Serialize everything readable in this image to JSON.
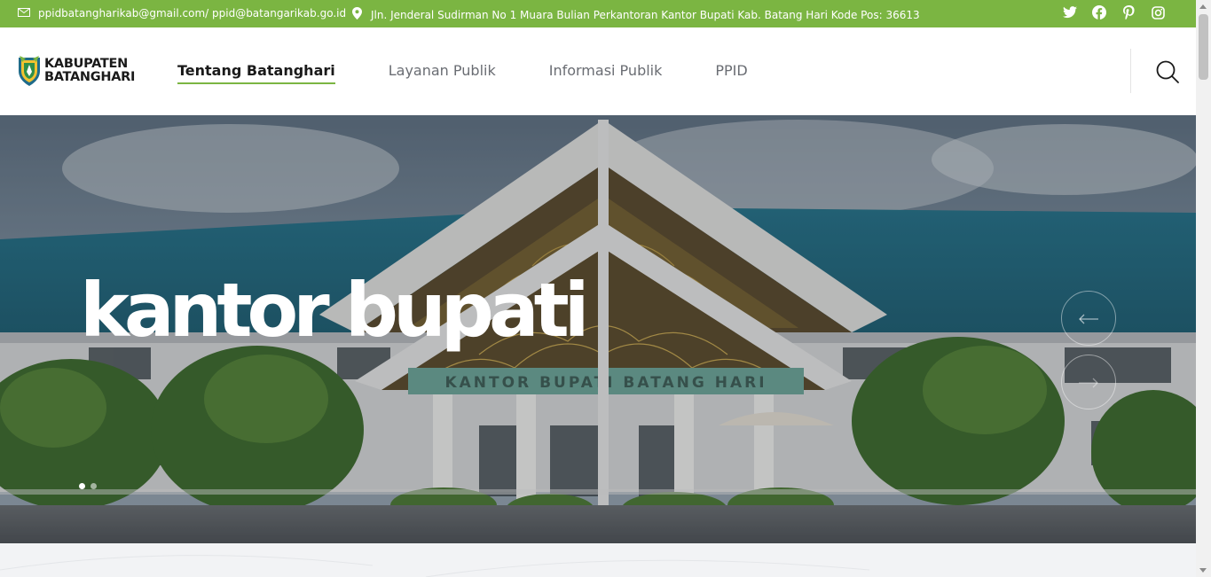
{
  "topbar": {
    "email": "ppidbatangharikab@gmail.com/ ppid@batangarikab.go.id",
    "address": "Jln. Jenderal Sudirman No 1 Muara Bulian Perkantoran Kantor Bupati Kab. Batang Hari Kode Pos: 36613",
    "social_icons": [
      "twitter-icon",
      "facebook-icon",
      "pinterest-icon",
      "instagram-icon"
    ]
  },
  "header": {
    "logo_line1": "KABUPATEN",
    "logo_line2": "BATANGHARI",
    "nav": [
      {
        "label": "Tentang Batanghari",
        "active": true
      },
      {
        "label": "Layanan Publik",
        "active": false
      },
      {
        "label": "Informasi Publik",
        "active": false
      },
      {
        "label": "PPID",
        "active": false
      }
    ]
  },
  "hero": {
    "title": "kantor bupati",
    "building_sign": "KANTOR BUPATI BATANG HARI",
    "active_slide": 1,
    "slide_count": 2
  },
  "colors": {
    "accent": "#7bb542",
    "roof": "#2f7f93"
  }
}
